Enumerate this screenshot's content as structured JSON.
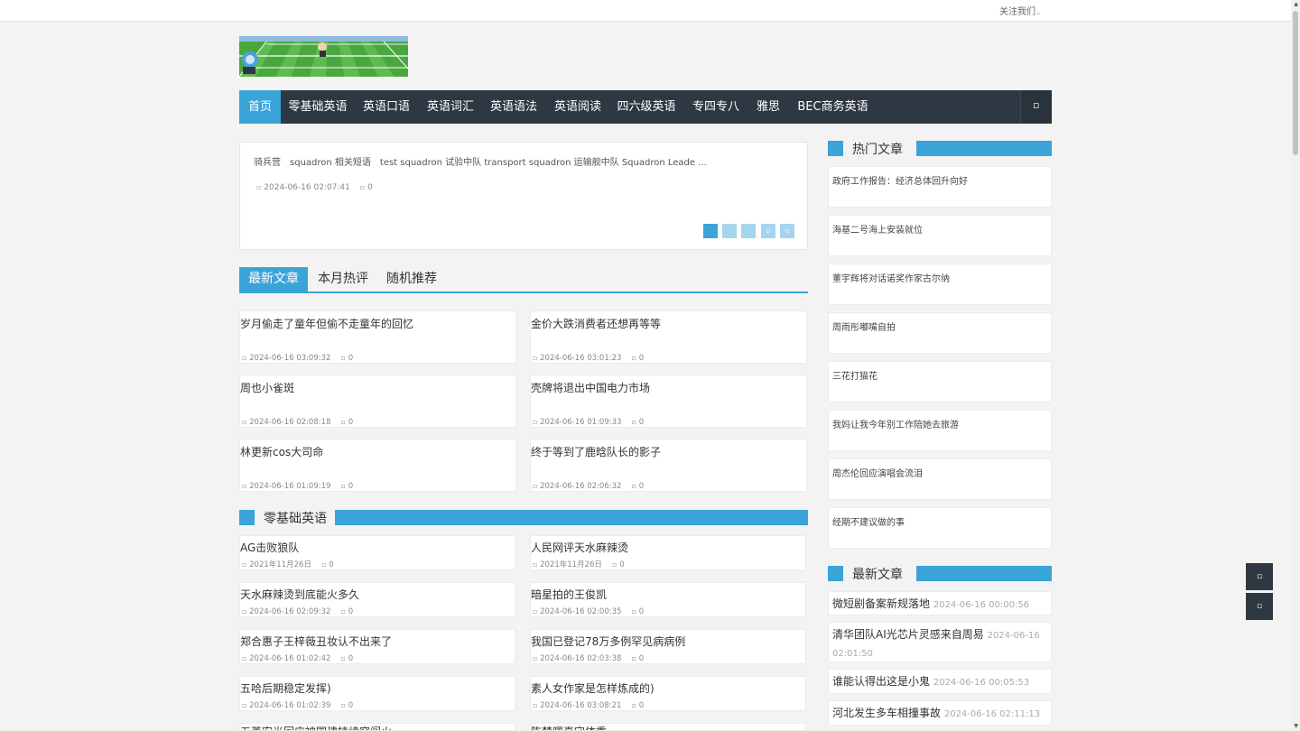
{
  "topbar": {
    "follow_label": "关注我们",
    "caret": "⌄"
  },
  "nav": {
    "items": [
      "首页",
      "零基础英语",
      "英语口语",
      "英语词汇",
      "英语语法",
      "英语阅读",
      "四六级英语",
      "专四专八",
      "雅思",
      "BEC商务英语"
    ],
    "search_glyph": "▫"
  },
  "slider": {
    "text": "骑兵营　squadron 相关短语　test squadron 试验中队 transport squadron 运输舰中队 Squadron Leade ...",
    "date": "2024-06-16 02:07:41",
    "comments": "0",
    "dots": [
      "1",
      "2",
      "3",
      "▫",
      "▫"
    ]
  },
  "tabs": [
    "最新文章",
    "本月热评",
    "随机推荐"
  ],
  "articles": [
    {
      "title": "岁月偷走了童年但偷不走童年的回忆",
      "date": "2024-06-16 03:09:32",
      "comments": "0"
    },
    {
      "title": "金价大跌消费者还想再等等",
      "date": "2024-06-16 03:01:23",
      "comments": "0"
    },
    {
      "title": "周也小雀斑",
      "date": "2024-06-16 02:08:18",
      "comments": "0"
    },
    {
      "title": "壳牌将退出中国电力市场",
      "date": "2024-06-16 01:09:33",
      "comments": "0"
    },
    {
      "title": "林更新cos大司命",
      "date": "2024-06-16 01:09:19",
      "comments": "0"
    },
    {
      "title": "终于等到了鹿晗队长的影子",
      "date": "2024-06-16 02:06:32",
      "comments": "0"
    }
  ],
  "section_basic": {
    "title": "零基础英语",
    "items": [
      {
        "title": "AG击败狼队",
        "date": "2021年11月26日",
        "comments": "0"
      },
      {
        "title": "人民网评天水麻辣烫",
        "date": "2021年11月26日",
        "comments": "0"
      },
      {
        "title": "天水麻辣烫到底能火多久",
        "date": "2024-06-16 02:09:32",
        "comments": "0"
      },
      {
        "title": "暗星拍的王俊凯",
        "date": "2024-06-16 02:00:35",
        "comments": "0"
      },
      {
        "title": "郑合惠子王梓薇丑妆认不出来了",
        "date": "2024-06-16 01:02:42",
        "comments": "0"
      },
      {
        "title": "我国已登记78万多例罕见病病例",
        "date": "2024-06-16 02:03:38",
        "comments": "0"
      },
      {
        "title": "五哈后期稳定发挥)",
        "date": "2024-06-16 01:02:39",
        "comments": "0"
      },
      {
        "title": "素人女作家是怎样炼成的)",
        "date": "2024-06-16 03:08:21",
        "comments": "0"
      },
      {
        "title": "五菱宏光回应被国建持续突闯火",
        "date": "",
        "comments": ""
      },
      {
        "title": "陈楚曙真守体重",
        "date": "",
        "comments": ""
      }
    ]
  },
  "hot": {
    "title": "热门文章",
    "items": [
      "政府工作报告：经济总体回升向好",
      "海基二号海上安装就位",
      "董宇辉将对话诺奖作家古尔纳",
      "周雨彤嘟嘴自拍",
      "三花打猫花",
      "我妈让我今年别工作陪她去旅游",
      "周杰伦回应演唱会流泪",
      "经期不建议做的事"
    ]
  },
  "latest": {
    "title": "最新文章",
    "items": [
      {
        "title": "微短剧备案新规落地",
        "date": "2024-06-16 00:00:56"
      },
      {
        "title": "清华团队AI光芯片灵感来自周易",
        "date": "2024-06-16 02:01:50"
      },
      {
        "title": "谁能认得出这是小鬼",
        "date": "2024-06-16 00:05:53"
      },
      {
        "title": "河北发生多车相撞事故",
        "date": "2024-06-16 02:11:13"
      }
    ]
  },
  "side_buttons": [
    "▫",
    "▫"
  ],
  "icons": {
    "date": "▫",
    "comment": "▫"
  },
  "colors": {
    "accent": "#3aa4d8",
    "nav_bg": "#2f3842"
  }
}
